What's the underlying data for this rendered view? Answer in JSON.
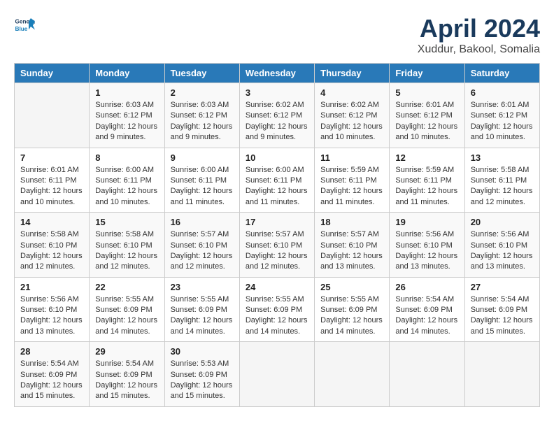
{
  "header": {
    "logo_line1": "General",
    "logo_line2": "Blue",
    "month_title": "April 2024",
    "location": "Xuddur, Bakool, Somalia"
  },
  "weekdays": [
    "Sunday",
    "Monday",
    "Tuesday",
    "Wednesday",
    "Thursday",
    "Friday",
    "Saturday"
  ],
  "weeks": [
    [
      {
        "day": "",
        "info": ""
      },
      {
        "day": "1",
        "info": "Sunrise: 6:03 AM\nSunset: 6:12 PM\nDaylight: 12 hours and 9 minutes."
      },
      {
        "day": "2",
        "info": "Sunrise: 6:03 AM\nSunset: 6:12 PM\nDaylight: 12 hours and 9 minutes."
      },
      {
        "day": "3",
        "info": "Sunrise: 6:02 AM\nSunset: 6:12 PM\nDaylight: 12 hours and 9 minutes."
      },
      {
        "day": "4",
        "info": "Sunrise: 6:02 AM\nSunset: 6:12 PM\nDaylight: 12 hours and 10 minutes."
      },
      {
        "day": "5",
        "info": "Sunrise: 6:01 AM\nSunset: 6:12 PM\nDaylight: 12 hours and 10 minutes."
      },
      {
        "day": "6",
        "info": "Sunrise: 6:01 AM\nSunset: 6:12 PM\nDaylight: 12 hours and 10 minutes."
      }
    ],
    [
      {
        "day": "7",
        "info": "Sunrise: 6:01 AM\nSunset: 6:11 PM\nDaylight: 12 hours and 10 minutes."
      },
      {
        "day": "8",
        "info": "Sunrise: 6:00 AM\nSunset: 6:11 PM\nDaylight: 12 hours and 10 minutes."
      },
      {
        "day": "9",
        "info": "Sunrise: 6:00 AM\nSunset: 6:11 PM\nDaylight: 12 hours and 11 minutes."
      },
      {
        "day": "10",
        "info": "Sunrise: 6:00 AM\nSunset: 6:11 PM\nDaylight: 12 hours and 11 minutes."
      },
      {
        "day": "11",
        "info": "Sunrise: 5:59 AM\nSunset: 6:11 PM\nDaylight: 12 hours and 11 minutes."
      },
      {
        "day": "12",
        "info": "Sunrise: 5:59 AM\nSunset: 6:11 PM\nDaylight: 12 hours and 11 minutes."
      },
      {
        "day": "13",
        "info": "Sunrise: 5:58 AM\nSunset: 6:11 PM\nDaylight: 12 hours and 12 minutes."
      }
    ],
    [
      {
        "day": "14",
        "info": "Sunrise: 5:58 AM\nSunset: 6:10 PM\nDaylight: 12 hours and 12 minutes."
      },
      {
        "day": "15",
        "info": "Sunrise: 5:58 AM\nSunset: 6:10 PM\nDaylight: 12 hours and 12 minutes."
      },
      {
        "day": "16",
        "info": "Sunrise: 5:57 AM\nSunset: 6:10 PM\nDaylight: 12 hours and 12 minutes."
      },
      {
        "day": "17",
        "info": "Sunrise: 5:57 AM\nSunset: 6:10 PM\nDaylight: 12 hours and 12 minutes."
      },
      {
        "day": "18",
        "info": "Sunrise: 5:57 AM\nSunset: 6:10 PM\nDaylight: 12 hours and 13 minutes."
      },
      {
        "day": "19",
        "info": "Sunrise: 5:56 AM\nSunset: 6:10 PM\nDaylight: 12 hours and 13 minutes."
      },
      {
        "day": "20",
        "info": "Sunrise: 5:56 AM\nSunset: 6:10 PM\nDaylight: 12 hours and 13 minutes."
      }
    ],
    [
      {
        "day": "21",
        "info": "Sunrise: 5:56 AM\nSunset: 6:10 PM\nDaylight: 12 hours and 13 minutes."
      },
      {
        "day": "22",
        "info": "Sunrise: 5:55 AM\nSunset: 6:09 PM\nDaylight: 12 hours and 14 minutes."
      },
      {
        "day": "23",
        "info": "Sunrise: 5:55 AM\nSunset: 6:09 PM\nDaylight: 12 hours and 14 minutes."
      },
      {
        "day": "24",
        "info": "Sunrise: 5:55 AM\nSunset: 6:09 PM\nDaylight: 12 hours and 14 minutes."
      },
      {
        "day": "25",
        "info": "Sunrise: 5:55 AM\nSunset: 6:09 PM\nDaylight: 12 hours and 14 minutes."
      },
      {
        "day": "26",
        "info": "Sunrise: 5:54 AM\nSunset: 6:09 PM\nDaylight: 12 hours and 14 minutes."
      },
      {
        "day": "27",
        "info": "Sunrise: 5:54 AM\nSunset: 6:09 PM\nDaylight: 12 hours and 15 minutes."
      }
    ],
    [
      {
        "day": "28",
        "info": "Sunrise: 5:54 AM\nSunset: 6:09 PM\nDaylight: 12 hours and 15 minutes."
      },
      {
        "day": "29",
        "info": "Sunrise: 5:54 AM\nSunset: 6:09 PM\nDaylight: 12 hours and 15 minutes."
      },
      {
        "day": "30",
        "info": "Sunrise: 5:53 AM\nSunset: 6:09 PM\nDaylight: 12 hours and 15 minutes."
      },
      {
        "day": "",
        "info": ""
      },
      {
        "day": "",
        "info": ""
      },
      {
        "day": "",
        "info": ""
      },
      {
        "day": "",
        "info": ""
      }
    ]
  ]
}
